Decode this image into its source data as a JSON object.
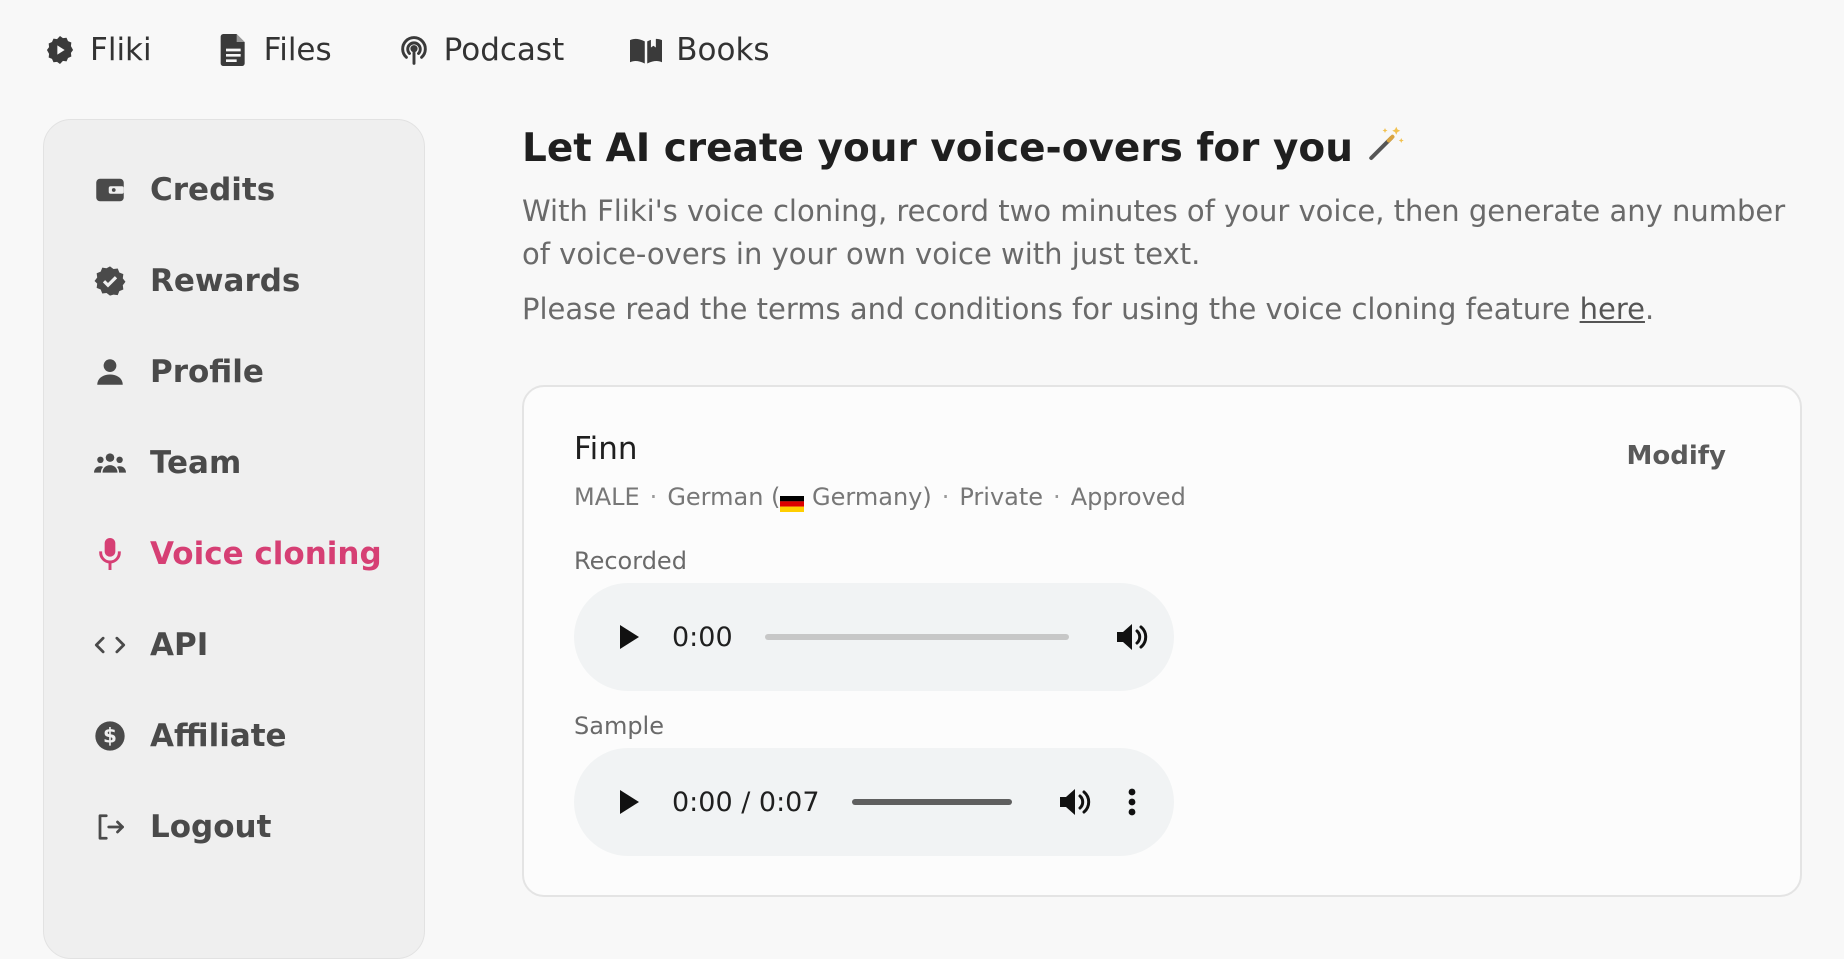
{
  "topnav": {
    "items": [
      {
        "label": "Fliki",
        "icon": "fliki-gear-play-icon"
      },
      {
        "label": "Files",
        "icon": "file-icon"
      },
      {
        "label": "Podcast",
        "icon": "podcast-icon"
      },
      {
        "label": "Books",
        "icon": "book-open-icon"
      }
    ]
  },
  "sidebar": {
    "items": [
      {
        "label": "Credits",
        "icon": "wallet-icon"
      },
      {
        "label": "Rewards",
        "icon": "verified-badge-icon"
      },
      {
        "label": "Profile",
        "icon": "person-icon"
      },
      {
        "label": "Team",
        "icon": "team-icon"
      },
      {
        "label": "Voice cloning",
        "icon": "microphone-icon",
        "active": true
      },
      {
        "label": "API",
        "icon": "code-icon"
      },
      {
        "label": "Affiliate",
        "icon": "dollar-circle-icon"
      },
      {
        "label": "Logout",
        "icon": "logout-icon"
      }
    ],
    "active_color": "#d63f74"
  },
  "main": {
    "headline": "Let AI create your voice-overs for you",
    "description": "With Fliki's voice cloning, record two minutes of your voice, then generate any number of voice-overs in your own voice with just text.",
    "terms_prefix": "Please read the terms and conditions for using the voice cloning feature ",
    "terms_link": "here",
    "terms_suffix": "."
  },
  "card": {
    "voice_name": "Finn",
    "modify_label": "Modify",
    "gender": "MALE",
    "language_prefix": "German (",
    "language_suffix": " Germany)",
    "visibility": "Private",
    "status": "Approved",
    "separator": "·",
    "recorded_label": "Recorded",
    "recorded_time": "0:00",
    "sample_label": "Sample",
    "sample_time": "0:00 / 0:07"
  }
}
